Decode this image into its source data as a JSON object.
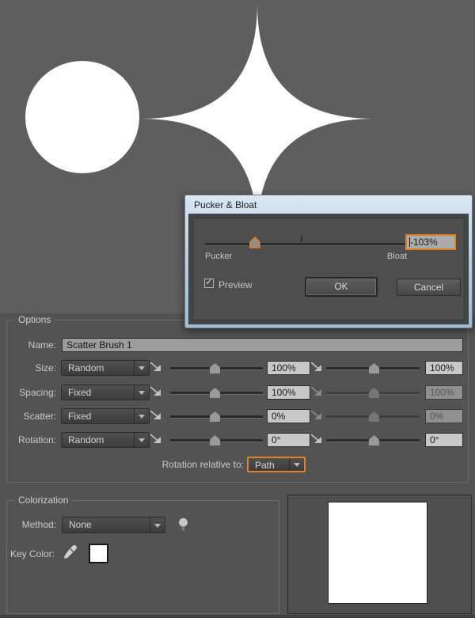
{
  "artboard": {
    "background": "#5e5e5e",
    "shape_color": "#ffffff",
    "shapes": [
      "circle",
      "pucker-bloat-star"
    ]
  },
  "accent_color": "#e0831f",
  "icons": {
    "checkbox_check": "✓"
  },
  "dialog": {
    "title": "Pucker & Bloat",
    "slider": {
      "min_label": "Pucker",
      "max_label": "Bloat",
      "value": "-103%"
    },
    "preview_label": "Preview",
    "ok_label": "OK",
    "cancel_label": "Cancel"
  },
  "options": {
    "legend": "Options",
    "name_label": "Name:",
    "name_value": "Scatter Brush 1",
    "rows": [
      {
        "label": "Size:",
        "mode": "Random",
        "value1": "100%",
        "value2": "100%"
      },
      {
        "label": "Spacing:",
        "mode": "Fixed",
        "value1": "100%",
        "value2": "100%"
      },
      {
        "label": "Scatter:",
        "mode": "Fixed",
        "value1": "0%",
        "value2": "0%"
      },
      {
        "label": "Rotation:",
        "mode": "Random",
        "value1": "0°",
        "value2": "0°"
      }
    ],
    "rotation_relative_label": "Rotation relative to:",
    "rotation_relative_value": "Path"
  },
  "colorization": {
    "legend": "Colorization",
    "method_label": "Method:",
    "method_value": "None",
    "key_color_label": "Key Color:",
    "key_color": "#ffffff"
  },
  "preview_panel": {
    "swatch_color": "#ffffff"
  }
}
